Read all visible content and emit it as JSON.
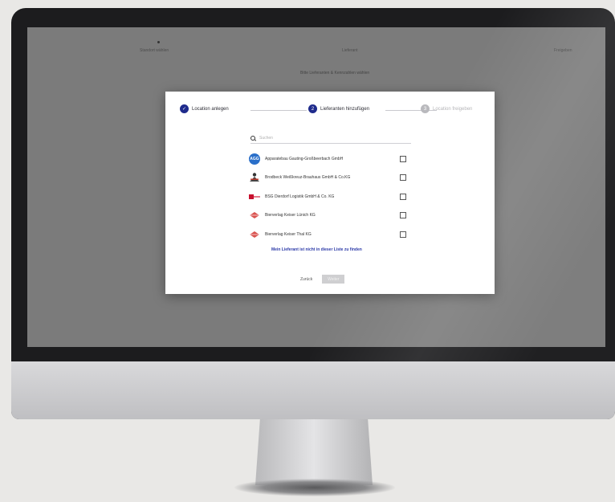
{
  "background": {
    "steps": [
      {
        "label": "Standort wählen"
      },
      {
        "label": "Lieferant"
      },
      {
        "label": "Freigeben"
      }
    ],
    "subtitle": "Bitte Lieferanten & Kennzahlen wählen"
  },
  "modal": {
    "steps": [
      {
        "label": "Location anlegen",
        "state": "done"
      },
      {
        "number": "2",
        "label": "Lieferanten hinzufügen",
        "state": "active"
      },
      {
        "number": "3",
        "label": "Location freigeben",
        "state": "pending"
      }
    ],
    "search": {
      "placeholder": "Suchen"
    },
    "suppliers": [
      {
        "name": "Apparatebau Gauting-Großbeerbach GmbH",
        "logo": "circle-initials",
        "initials": "AGG",
        "checked": false
      },
      {
        "name": "Brodbeck Weißkreuz-Brauhaus GmbH & Co.KG",
        "logo": "person-icon",
        "checked": false
      },
      {
        "name": "BSG Dierdorf Logistik GmbH & Co. KG",
        "logo": "bar-logo",
        "checked": false
      },
      {
        "name": "Bierverlag Keiser Lünich KG",
        "logo": "diamond-logo",
        "checked": false
      },
      {
        "name": "Bierverlag Keiser Thal KG",
        "logo": "diamond-logo",
        "checked": false
      }
    ],
    "not_found_link": "Mein Lieferant ist nicht in dieser Liste zu finden",
    "back_label": "Zurück",
    "next_label": "Weiter"
  },
  "colors": {
    "accent": "#1f2b8c",
    "link": "#2c3aa8",
    "disabled_button": "#cfcfd1",
    "overlay": "#7b7b7b"
  }
}
